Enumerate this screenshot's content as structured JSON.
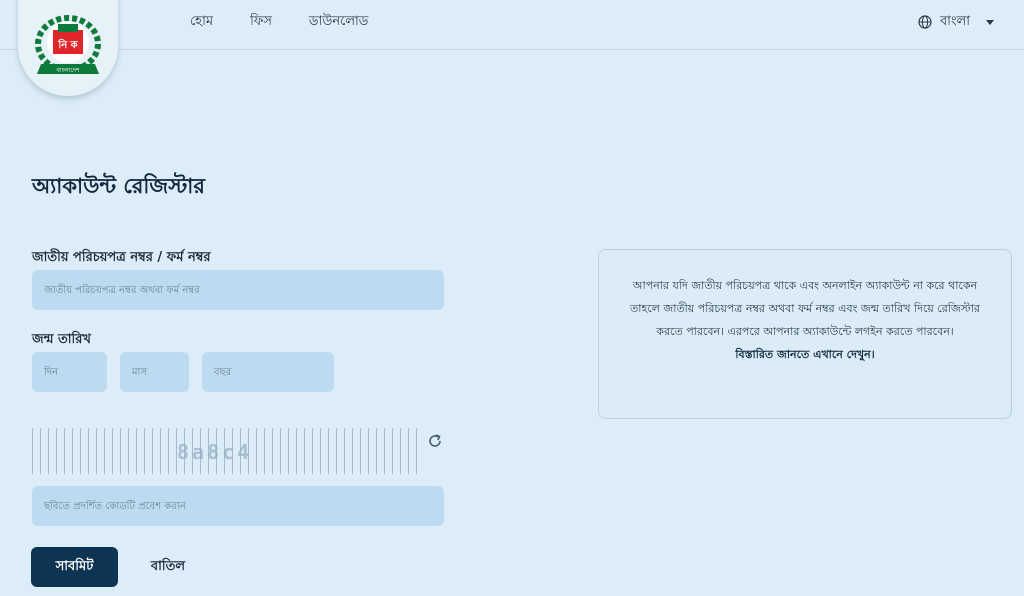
{
  "header": {
    "logo_text": "বাংলাদেশ",
    "logo_letters": "নি ক",
    "nav": [
      {
        "label": "হোম"
      },
      {
        "label": "ফিস"
      },
      {
        "label": "ডাউনলোড"
      }
    ],
    "language": "বাংলা"
  },
  "main": {
    "title": "অ্যাকাউন্ট রেজিস্টার",
    "nid_label": "জাতীয় পরিচয়পত্র নম্বর / ফর্ম নম্বর",
    "nid_placeholder": "জাতীয় পরিচয়পত্র নম্বর অথবা ফর্ম নম্বর",
    "dob_label": "জন্ম তারিখ",
    "day_placeholder": "দিন",
    "month_placeholder": "মাস",
    "year_placeholder": "বছর",
    "captcha_text": "8a8c4",
    "captcha_placeholder": "ছবিতে প্রদর্শিত কোডটি প্রবেশ করান",
    "submit_label": "সাবমিট",
    "cancel_label": "বাতিল"
  },
  "info": {
    "text": "আপনার যদি জাতীয় পরিচয়পত্র থাকে এবং অনলাইন অ্যাকাউন্ট না করে থাকেন তাহলে জাতীয় পরিচয়পত্র নম্বর অথবা ফর্ম নম্বর এবং জন্ম তারিখ দিয়ে রেজিস্টার করতে পারবেন। এরপরে আপনার অ্যাকাউন্টে লগইন করতে পারবেন।",
    "link": "বিস্তারিত জানতে এখানে দেখুন।"
  },
  "colors": {
    "background": "#dcedf7",
    "field": "#bcdaf0",
    "primary_button": "#0e3454",
    "logo_green": "#0c7a3a",
    "logo_red": "#e0252b"
  }
}
